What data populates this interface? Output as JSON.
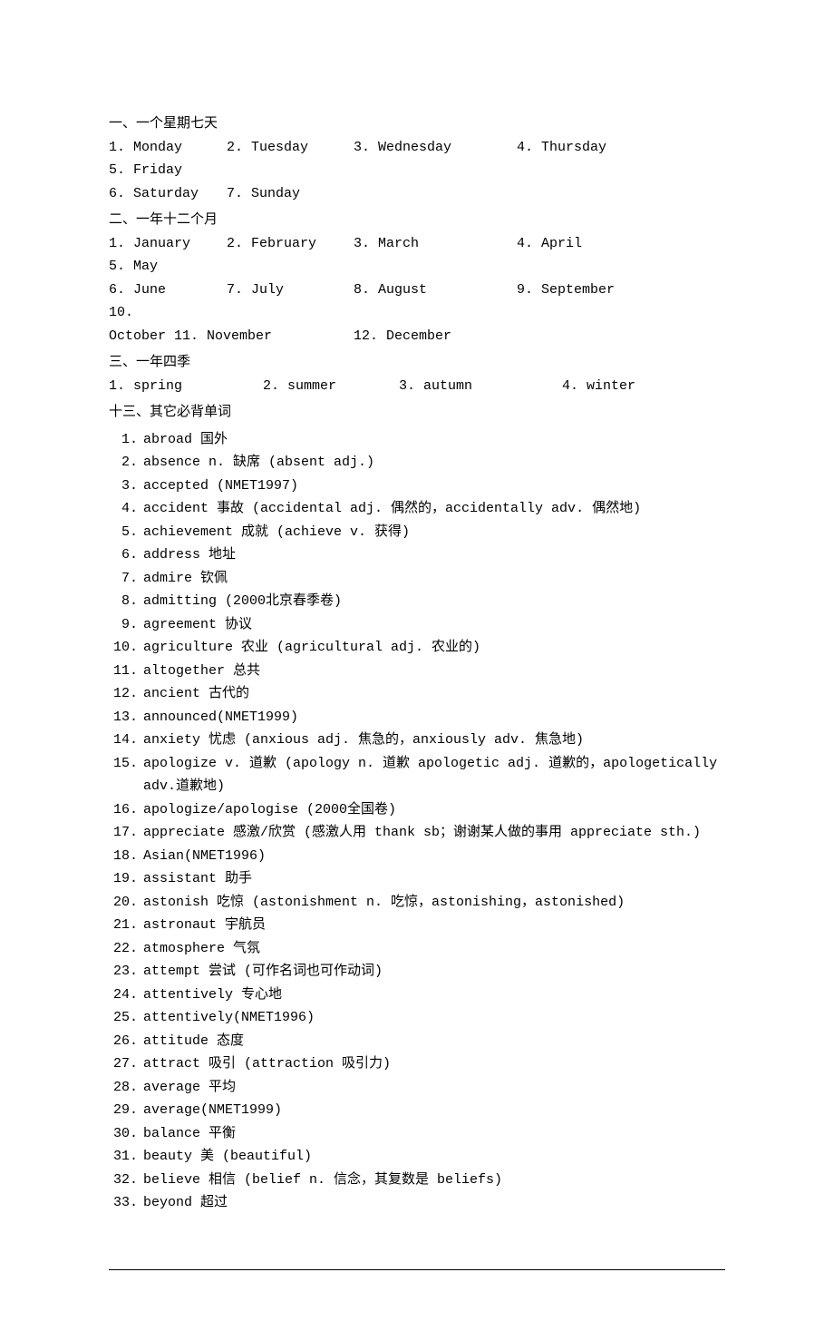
{
  "section1": {
    "title": "一、一个星期七天",
    "items": [
      "1. Monday",
      "2. Tuesday",
      "3. Wednesday",
      "4. Thursday",
      "5. Friday",
      "6. Saturday",
      "7. Sunday"
    ]
  },
  "section2": {
    "title": "二、一年十二个月",
    "items": [
      "1. January",
      "2. February",
      "3. March",
      "4. April",
      "5. May",
      "6. June",
      "7. July",
      "8. August",
      "9. September",
      "10.",
      "October 11. November",
      "12. December"
    ]
  },
  "section3": {
    "title": "三、一年四季",
    "items": [
      "1. spring",
      "2. summer",
      "3. autumn",
      "4. winter"
    ]
  },
  "section13": {
    "title": "十三、其它必背单词",
    "items": [
      {
        "n": "1.",
        "t": "abroad 国外"
      },
      {
        "n": "2.",
        "t": "absence n. 缺席 (absent adj.)"
      },
      {
        "n": "3.",
        "t": "accepted (NMET1997)"
      },
      {
        "n": "4.",
        "t": "accident 事故 (accidental adj. 偶然的，accidentally adv. 偶然地)"
      },
      {
        "n": "5.",
        "t": "achievement 成就 (achieve v. 获得)"
      },
      {
        "n": "6.",
        "t": "address 地址"
      },
      {
        "n": "7.",
        "t": "admire 钦佩"
      },
      {
        "n": "8.",
        "t": "admitting (2000北京春季卷)"
      },
      {
        "n": "9.",
        "t": "agreement 协议"
      },
      {
        "n": "10.",
        "t": "agriculture 农业 (agricultural adj. 农业的)"
      },
      {
        "n": "11.",
        "t": "altogether 总共"
      },
      {
        "n": "12.",
        "t": "ancient 古代的"
      },
      {
        "n": "13.",
        "t": "announced(NMET1999)"
      },
      {
        "n": "14.",
        "t": "anxiety 忧虑 (anxious adj. 焦急的，anxiously adv. 焦急地)"
      },
      {
        "n": "15.",
        "t": "apologize v. 道歉 (apology n. 道歉 apologetic adj. 道歉的，apologetically adv.道歉地)"
      },
      {
        "n": "16.",
        "t": "apologize/apologise (2000全国卷)"
      },
      {
        "n": "17.",
        "t": "appreciate 感激/欣赏 (感激人用 thank sb；谢谢某人做的事用 appreciate sth.)"
      },
      {
        "n": "18.",
        "t": "Asian(NMET1996)"
      },
      {
        "n": "19.",
        "t": "assistant 助手"
      },
      {
        "n": "20.",
        "t": "astonish 吃惊 (astonishment n. 吃惊，astonishing，astonished)"
      },
      {
        "n": "21.",
        "t": "astronaut 宇航员"
      },
      {
        "n": "22.",
        "t": "atmosphere 气氛"
      },
      {
        "n": "23.",
        "t": "attempt 尝试 (可作名词也可作动词)"
      },
      {
        "n": "24.",
        "t": "attentively 专心地"
      },
      {
        "n": "25.",
        "t": "attentively(NMET1996)"
      },
      {
        "n": "26.",
        "t": "attitude 态度"
      },
      {
        "n": "27.",
        "t": "attract 吸引 (attraction 吸引力)"
      },
      {
        "n": "28.",
        "t": "average 平均"
      },
      {
        "n": "29.",
        "t": "average(NMET1999)"
      },
      {
        "n": "30.",
        "t": "balance 平衡"
      },
      {
        "n": "31.",
        "t": "beauty 美 (beautiful)"
      },
      {
        "n": "32.",
        "t": "believe 相信 (belief n. 信念，其复数是 beliefs)"
      },
      {
        "n": "33.",
        "t": "beyond 超过"
      }
    ]
  }
}
